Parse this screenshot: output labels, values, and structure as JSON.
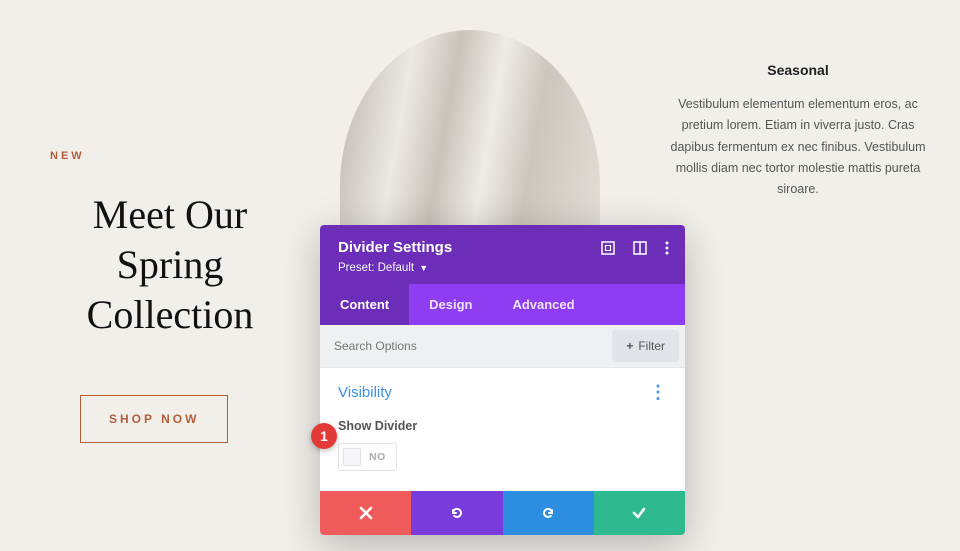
{
  "hero": {
    "eyebrow": "NEW",
    "headline_l1": "Meet Our",
    "headline_l2": "Spring",
    "headline_l3": "Collection",
    "shop_button": "SHOP NOW"
  },
  "feature": {
    "title": "Seasonal",
    "body": "Vestibulum elementum elementum eros, ac pretium lorem. Etiam in viverra justo. Cras dapibus fermentum ex nec finibus. Vestibulum mollis diam nec tortor molestie mattis pureta siroare."
  },
  "panel": {
    "title": "Divider Settings",
    "preset": "Preset: Default",
    "tabs": {
      "content": "Content",
      "design": "Design",
      "advanced": "Advanced"
    },
    "search_placeholder": "Search Options",
    "filter_label": "Filter",
    "section": {
      "title": "Visibility",
      "option_label": "Show Divider",
      "toggle_value": "NO"
    }
  },
  "annotation": {
    "step_1": "1"
  }
}
